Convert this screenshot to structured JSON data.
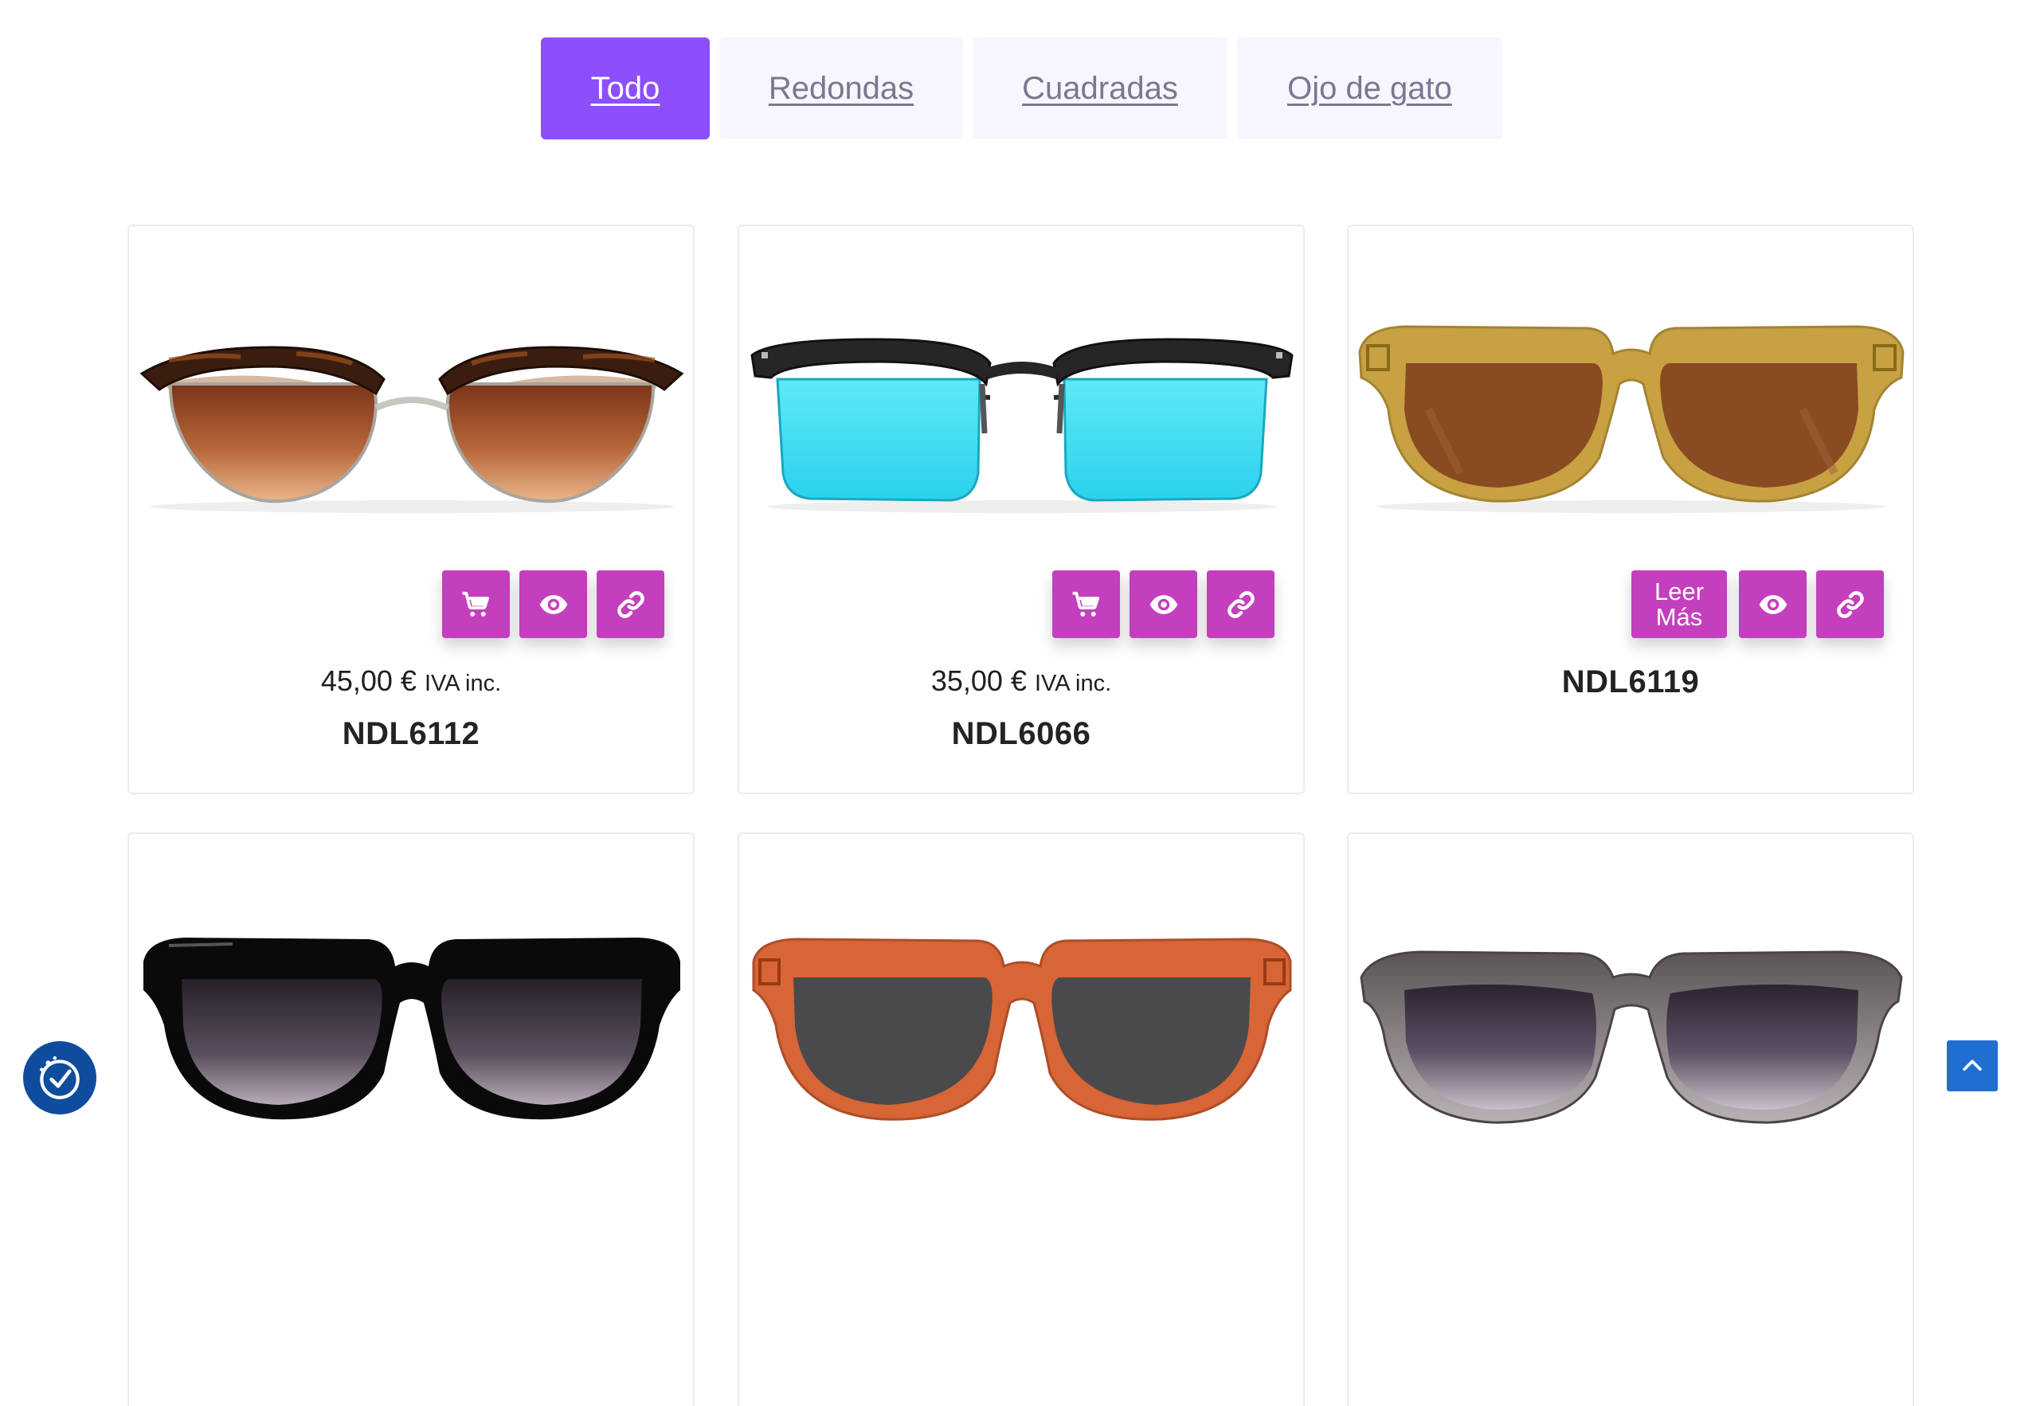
{
  "filters": {
    "tabs": [
      {
        "label": "Todo",
        "active": true
      },
      {
        "label": "Redondas",
        "active": false
      },
      {
        "label": "Cuadradas",
        "active": false
      },
      {
        "label": "Ojo de gato",
        "active": false
      }
    ]
  },
  "accent_colors": {
    "tab_active": "#8c4ffb",
    "action_button": "#c43fbe",
    "scroll_top": "#1f6fd1",
    "accessibility": "#0f4c9e"
  },
  "products": [
    {
      "name": "NDL6112",
      "price": "45,00 €",
      "tax_label": "IVA inc.",
      "frame": "tortoise-clubmaster",
      "actions": [
        "cart-icon",
        "eye-icon",
        "link-icon"
      ]
    },
    {
      "name": "NDL6066",
      "price": "35,00 €",
      "tax_label": "IVA inc.",
      "frame": "black-browline-blue-lens",
      "actions": [
        "cart-icon",
        "eye-icon",
        "link-icon"
      ]
    },
    {
      "name": "NDL6119",
      "read_more": "Leer Más",
      "frame": "mustard-square",
      "actions": [
        "read-more",
        "eye-icon",
        "link-icon"
      ]
    },
    {
      "frame": "black-square"
    },
    {
      "frame": "orange-square"
    },
    {
      "frame": "grey-round"
    }
  ]
}
